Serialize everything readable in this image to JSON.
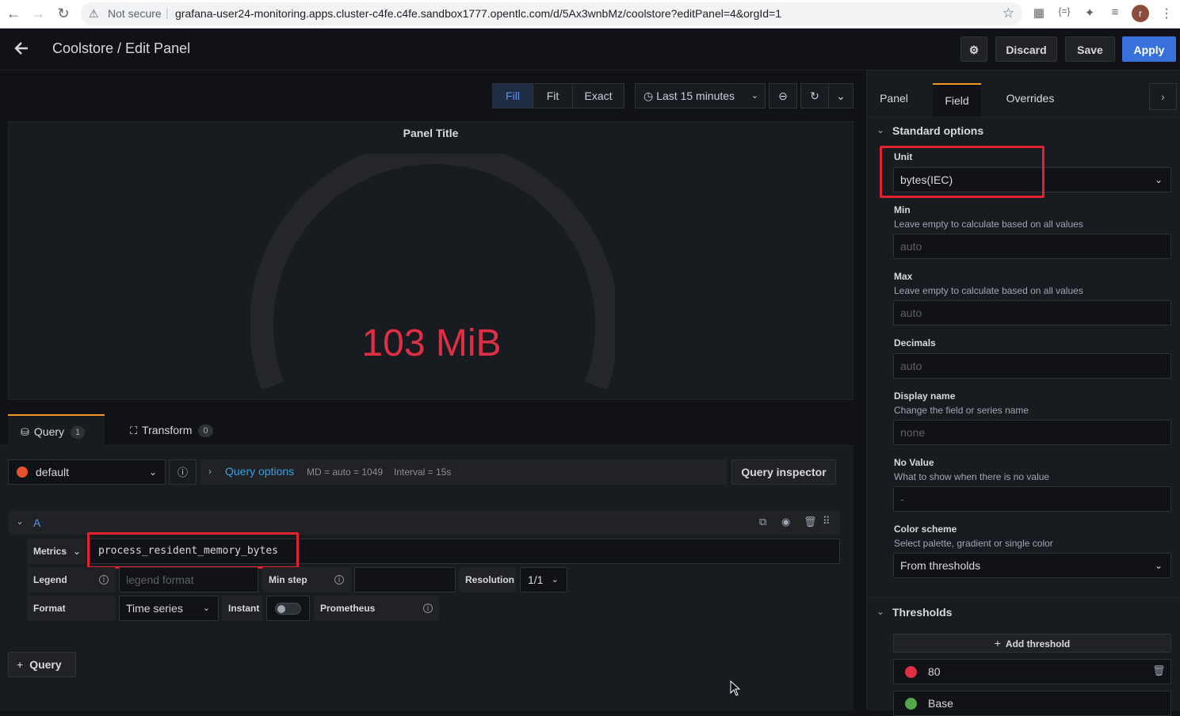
{
  "browser": {
    "security": "Not secure",
    "url": "grafana-user24-monitoring.apps.cluster-c4fe.c4fe.sandbox1777.opentlc.com/d/5Ax3wnbMz/coolstore?editPanel=4&orgId=1",
    "avatar_letter": "r"
  },
  "header": {
    "title": "Coolstore / Edit Panel",
    "discard": "Discard",
    "save": "Save",
    "apply": "Apply"
  },
  "toolbar": {
    "fill": "Fill",
    "fit": "Fit",
    "exact": "Exact",
    "time_range": "Last 15 minutes"
  },
  "panel": {
    "title": "Panel Title",
    "value": "103 MiB",
    "value_color": "#e02f44"
  },
  "query_tabs": {
    "query": "Query",
    "query_count": "1",
    "transform": "Transform",
    "transform_count": "0"
  },
  "datasource": {
    "name": "default",
    "query_options": "Query options",
    "md": "MD = auto = 1049",
    "interval": "Interval = 15s",
    "inspector": "Query inspector"
  },
  "query_a": {
    "ref": "A",
    "metrics_label": "Metrics",
    "metrics_value": "process_resident_memory_bytes",
    "legend_label": "Legend",
    "legend_placeholder": "legend format",
    "min_step_label": "Min step",
    "resolution_label": "Resolution",
    "resolution_value": "1/1",
    "format_label": "Format",
    "format_value": "Time series",
    "instant_label": "Instant",
    "prometheus_label": "Prometheus"
  },
  "add_query": "Query",
  "sidebar": {
    "tabs": [
      "Panel",
      "Field",
      "Overrides"
    ],
    "active_tab": "Field",
    "standard_options": "Standard options",
    "unit_label": "Unit",
    "unit_value": "bytes(IEC)",
    "min_label": "Min",
    "min_desc": "Leave empty to calculate based on all values",
    "min_placeholder": "auto",
    "max_label": "Max",
    "max_desc": "Leave empty to calculate based on all values",
    "max_placeholder": "auto",
    "decimals_label": "Decimals",
    "decimals_placeholder": "auto",
    "display_name_label": "Display name",
    "display_name_desc": "Change the field or series name",
    "display_name_placeholder": "none",
    "no_value_label": "No Value",
    "no_value_desc": "What to show when there is no value",
    "no_value_placeholder": "-",
    "color_scheme_label": "Color scheme",
    "color_scheme_desc": "Select palette, gradient or single color",
    "color_scheme_value": "From thresholds",
    "thresholds": "Thresholds",
    "add_threshold": "Add threshold",
    "threshold_80": "80",
    "threshold_base": "Base",
    "threshold_80_color": "#e02f44",
    "threshold_base_color": "#56a64b"
  },
  "colors": {
    "accent": "#3871dc",
    "active_tab_border": "#f79520",
    "highlight": "#e2222e",
    "link": "#33a2e5"
  }
}
